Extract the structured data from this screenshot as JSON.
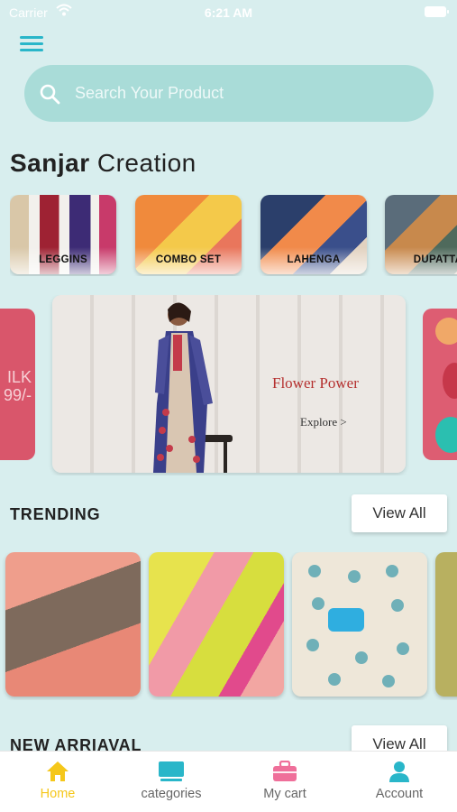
{
  "status_bar": {
    "carrier": "Carrier",
    "time": "6:21 AM"
  },
  "search": {
    "placeholder": "Search Your Product"
  },
  "brand": {
    "first": "Sanjar",
    "second": "Creation"
  },
  "categories": [
    {
      "label": "LEGGINS"
    },
    {
      "label": "COMBO SET"
    },
    {
      "label": "LAHENGA"
    },
    {
      "label": "DUPATTA"
    }
  ],
  "banner": {
    "left_promo_line1": "ILK",
    "left_promo_line2": "99/-",
    "heading": "Flower Power",
    "link": "Explore >"
  },
  "trending": {
    "title": "TRENDING",
    "view_all": "View All"
  },
  "new_arrival": {
    "title": "NEW ARRIAVAL",
    "view_all": "View All"
  },
  "tabs": [
    {
      "label": "Home",
      "icon": "home-icon",
      "active": true
    },
    {
      "label": "categories",
      "icon": "categories-icon",
      "active": false
    },
    {
      "label": "My cart",
      "icon": "cart-icon",
      "active": false
    },
    {
      "label": "Account",
      "icon": "account-icon",
      "active": false
    }
  ],
  "colors": {
    "background": "#d8eeee",
    "accent": "#29b6c9",
    "search_bg": "#a9dcd8",
    "active_tab": "#f5c71a",
    "cart_icon": "#ef6f9a"
  }
}
